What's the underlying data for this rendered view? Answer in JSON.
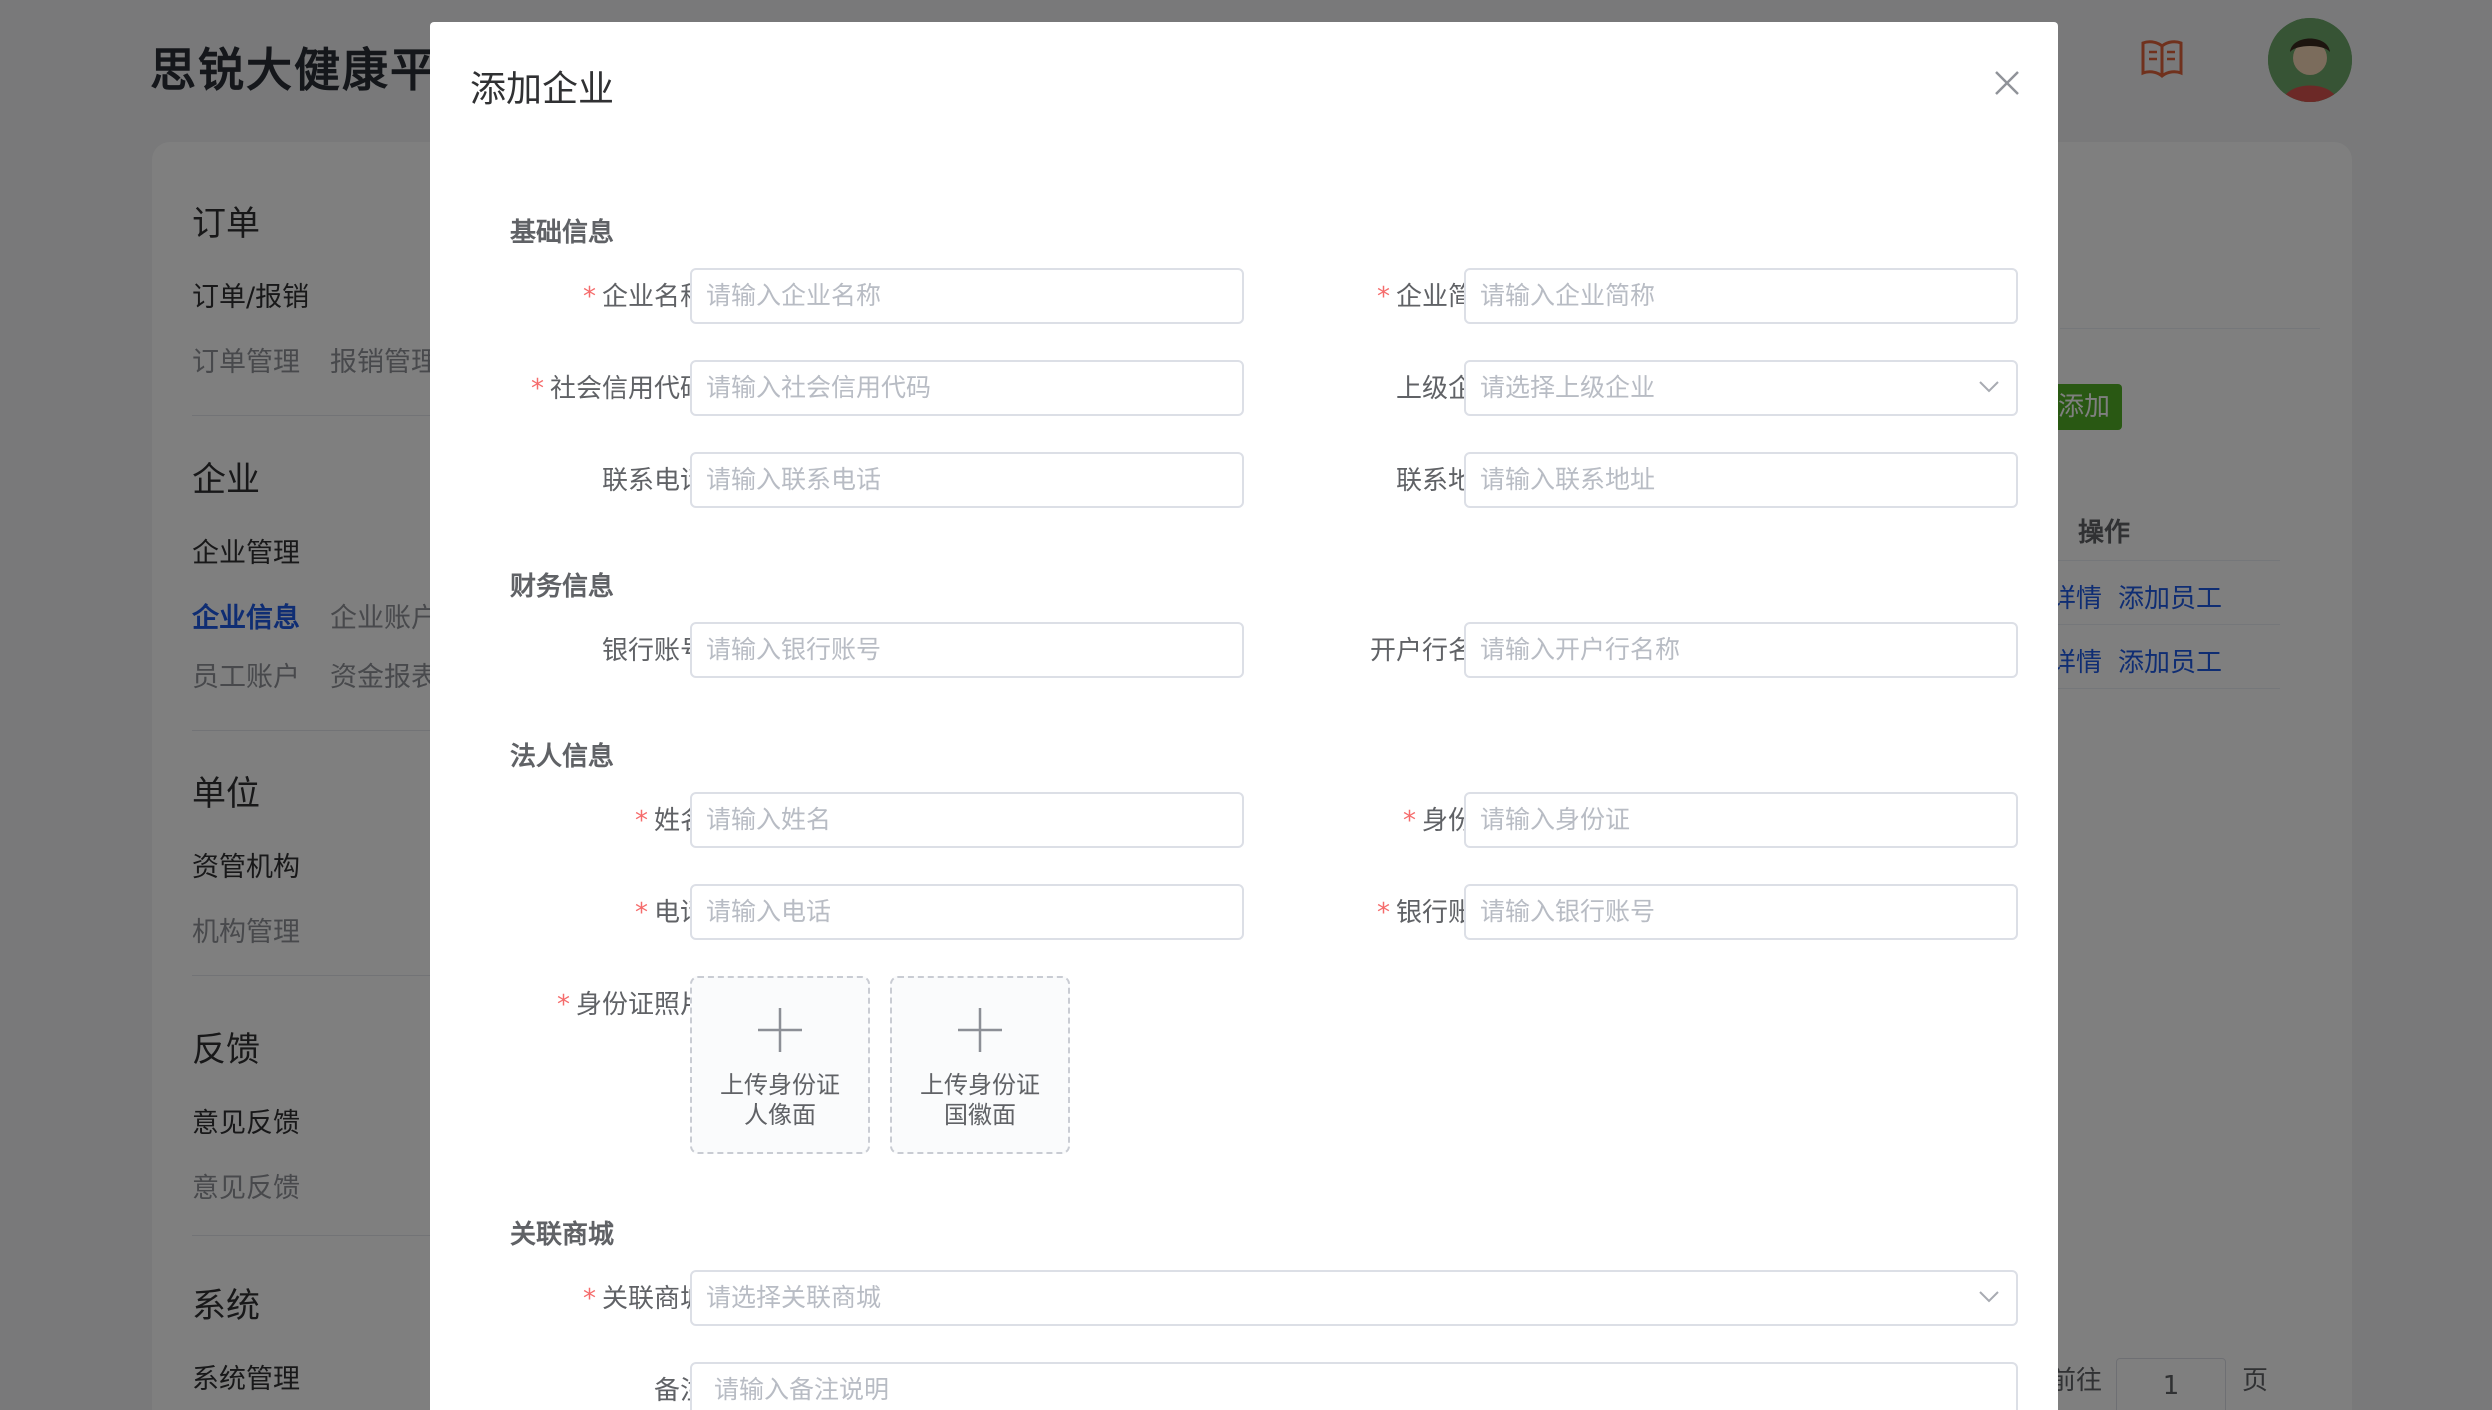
{
  "app": {
    "brand": "思锐大健康平",
    "sidebar": [
      {
        "title": "订单",
        "sub": "订单/报销",
        "links": [
          "订单管理",
          "报销管理"
        ]
      },
      {
        "title": "企业",
        "sub": "企业管理",
        "links": [
          "企业信息",
          "企业账户"
        ],
        "links2": [
          "员工账户",
          "资金报表"
        ]
      },
      {
        "title": "单位",
        "sub": "资管机构",
        "links": [
          "机构管理"
        ]
      },
      {
        "title": "反馈",
        "sub": "意见反馈",
        "links": [
          "意见反馈"
        ]
      },
      {
        "title": "系统",
        "sub": "系统管理"
      }
    ],
    "add_button": "添加",
    "column_operation": "操作",
    "rows": [
      {
        "detail": "详情",
        "add_employee": "添加员工"
      },
      {
        "detail": "详情",
        "add_employee": "添加员工"
      }
    ],
    "pager": {
      "goto": "前往",
      "page": "1",
      "unit": "页"
    }
  },
  "dialog": {
    "title": "添加企业",
    "sections": {
      "basic": "基础信息",
      "finance": "财务信息",
      "legal": "法人信息",
      "mall": "关联商城"
    },
    "fields": {
      "company_name": {
        "label": "企业名称",
        "required": true,
        "placeholder": "请输入企业名称"
      },
      "company_short": {
        "label": "企业简称",
        "required": true,
        "placeholder": "请输入企业简称"
      },
      "credit_code": {
        "label": "社会信用代码",
        "required": true,
        "placeholder": "请输入社会信用代码"
      },
      "parent_company": {
        "label": "上级企业",
        "required": false,
        "placeholder": "请选择上级企业"
      },
      "phone": {
        "label": "联系电话",
        "required": false,
        "placeholder": "请输入联系电话"
      },
      "address": {
        "label": "联系地址",
        "required": false,
        "placeholder": "请输入联系地址"
      },
      "bank_account": {
        "label": "银行账号",
        "required": false,
        "placeholder": "请输入银行账号"
      },
      "bank_name": {
        "label": "开户行名称",
        "required": false,
        "placeholder": "请输入开户行名称"
      },
      "legal_name": {
        "label": "姓名",
        "required": true,
        "placeholder": "请输入姓名"
      },
      "legal_id": {
        "label": "身份证",
        "required": true,
        "placeholder": "请输入身份证"
      },
      "legal_phone": {
        "label": "电话",
        "required": true,
        "placeholder": "请输入电话"
      },
      "legal_bank": {
        "label": "银行账号",
        "required": true,
        "placeholder": "请输入银行账号"
      },
      "id_photos": {
        "label": "身份证照片",
        "required": true
      },
      "mall": {
        "label": "关联商城",
        "required": true,
        "placeholder": "请选择关联商城"
      },
      "remark": {
        "label": "备注",
        "required": false,
        "placeholder": "请输入备注说明"
      }
    },
    "uploads": {
      "front": {
        "line1": "上传身份证",
        "line2": "人像面"
      },
      "back": {
        "line1": "上传身份证",
        "line2": "国徽面"
      }
    },
    "required_mark": "*"
  }
}
